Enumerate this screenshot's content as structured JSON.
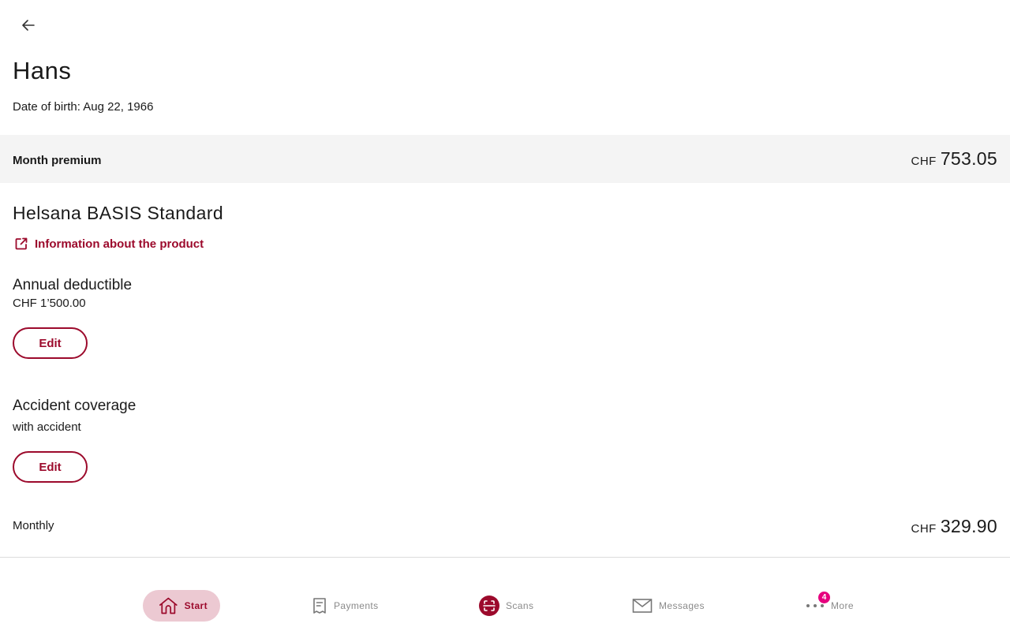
{
  "person": {
    "name": "Hans",
    "dob": "Date of birth: Aug 22, 1966"
  },
  "premium": {
    "label": "Month premium",
    "currency": "CHF",
    "value": "753.05"
  },
  "product": {
    "title": "Helsana BASIS Standard",
    "info_link": "Information about the product"
  },
  "deductible": {
    "title": "Annual deductible",
    "value": "CHF 1’500.00",
    "edit_label": "Edit"
  },
  "accident": {
    "title": "Accident coverage",
    "value": "with accident",
    "edit_label": "Edit"
  },
  "monthly": {
    "label": "Monthly",
    "currency": "CHF",
    "value": "329.90"
  },
  "nav": {
    "start": "Start",
    "payments": "Payments",
    "scans": "Scans",
    "messages": "Messages",
    "more": "More",
    "more_badge": "4"
  },
  "colors": {
    "brand": "#9c0a2c",
    "badge": "#e6007e",
    "active_nav_bg": "#ecc9d2"
  }
}
